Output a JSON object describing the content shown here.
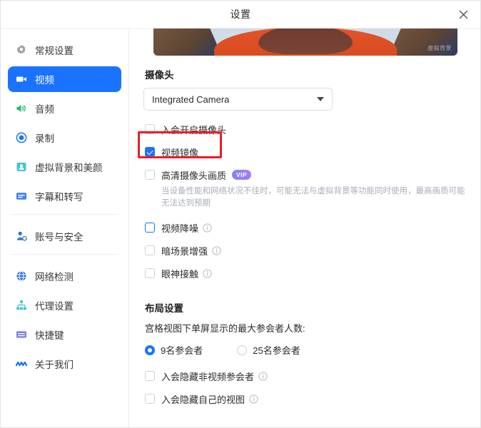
{
  "window": {
    "title": "设置",
    "close_icon": "close-icon"
  },
  "sidebar": {
    "items": [
      {
        "label": "常规设置",
        "icon": "gear-icon",
        "color": "#9aa0a8",
        "active": false,
        "divider_after": false
      },
      {
        "label": "视频",
        "icon": "camera-icon",
        "color": "#ffffff",
        "active": true,
        "divider_after": false
      },
      {
        "label": "音频",
        "icon": "speaker-icon",
        "color": "#23b26d",
        "active": false,
        "divider_after": false
      },
      {
        "label": "录制",
        "icon": "record-icon",
        "color": "#1a73ff",
        "active": false,
        "divider_after": false
      },
      {
        "label": "虚拟背景和美颜",
        "icon": "person-card-icon",
        "color": "#3fc6d4",
        "active": false,
        "divider_after": false
      },
      {
        "label": "字幕和转写",
        "icon": "caption-icon",
        "color": "#3b82f6",
        "active": false,
        "divider_after": true
      },
      {
        "label": "账号与安全",
        "icon": "account-security-icon",
        "color": "#2f6fe0",
        "active": false,
        "divider_after": true
      },
      {
        "label": "网络检测",
        "icon": "globe-icon",
        "color": "#2f6fe0",
        "active": false,
        "divider_after": false
      },
      {
        "label": "代理设置",
        "icon": "sitemap-icon",
        "color": "#3fc6d4",
        "active": false,
        "divider_after": false
      },
      {
        "label": "快捷键",
        "icon": "keyboard-icon",
        "color": "#7b7df0",
        "active": false,
        "divider_after": false
      },
      {
        "label": "关于我们",
        "icon": "about-icon",
        "color": "#1a73ff",
        "active": false,
        "divider_after": false
      }
    ]
  },
  "preview": {
    "watermark": "虚拟背景"
  },
  "camera": {
    "section_title": "摄像头",
    "select_value": "Integrated Camera",
    "options": [
      "Integrated Camera"
    ],
    "checkboxes": [
      {
        "label": "入会开启摄像头",
        "checked": false,
        "focus": false,
        "info": false,
        "vip": false
      },
      {
        "label": "视频镜像",
        "checked": true,
        "focus": false,
        "info": false,
        "vip": false
      },
      {
        "label": "高清摄像头画质",
        "checked": false,
        "focus": false,
        "info": false,
        "vip": true
      }
    ],
    "vip_badge": "VIP",
    "help_text": "当设备性能和网络状况不佳时，可能无法与虚拟背景等功能同时使用，最高画质可能无法达到预期",
    "quality_checkboxes": [
      {
        "label": "视频降噪",
        "checked": false,
        "focus": true,
        "info": true
      },
      {
        "label": "暗场景增强",
        "checked": false,
        "focus": false,
        "info": true
      },
      {
        "label": "眼神接触",
        "checked": false,
        "focus": false,
        "info": true
      }
    ]
  },
  "layout": {
    "section_title": "布局设置",
    "description": "宫格视图下单屏显示的最大参会者人数:",
    "radios": [
      {
        "label": "9名参会者",
        "selected": true
      },
      {
        "label": "25名参会者",
        "selected": false
      }
    ],
    "checkboxes": [
      {
        "label": "入会隐藏非视频参会者",
        "checked": false,
        "info": true
      },
      {
        "label": "入会隐藏自己的视图",
        "checked": false,
        "info": true
      }
    ]
  },
  "annotation": {
    "target": "视频镜像",
    "color": "#ee1c25"
  }
}
